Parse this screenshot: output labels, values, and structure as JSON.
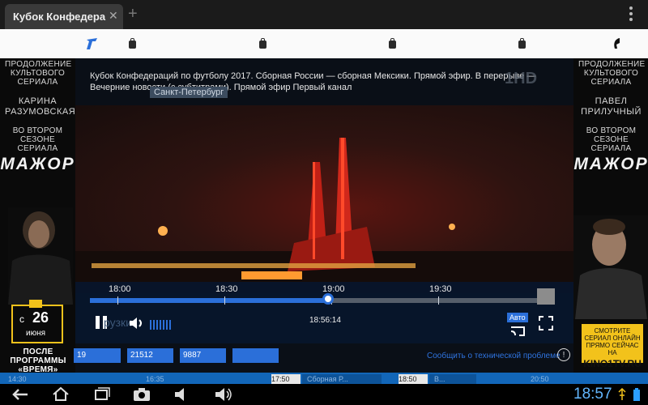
{
  "browser": {
    "tab_title": "Кубок Конфедера",
    "tab_close": "✕",
    "new_tab": "+"
  },
  "player": {
    "caption": "Кубок Конфедераций по футболу 2017. Сборная России — сборная Мексики. Прямой эфир. В перерыве — Вечерние новости (с субтитрами). Прямой эфир Первый канал",
    "location": "Санкт-Петербург",
    "channel_logo": "1HD",
    "timeline": {
      "ticks": [
        "18:00",
        "18:30",
        "19:00",
        "19:30"
      ],
      "progress": 0.53
    },
    "current_time": "18:56:14",
    "quality_label": "Авто",
    "ghost_text": "рузки..."
  },
  "left_ad": {
    "tagline": "ПРОДОЛЖЕНИЕ КУЛЬТОВОГО СЕРИАЛА",
    "actor": "КАРИНА РАЗУМОВСКАЯ",
    "season": "ВО ВТОРОМ СЕЗОНЕ СЕРИАЛА",
    "show": "МАЖОР",
    "date_prefix": "с",
    "date_day": "26",
    "date_month": "июня",
    "after": "ПОСЛЕ ПРОГРАММЫ «ВРЕМЯ»"
  },
  "right_ad": {
    "tagline": "ПРОДОЛЖЕНИЕ КУЛЬТОВОГО СЕРИАЛА",
    "actor": "ПАВЕЛ ПРИЛУЧНЫЙ",
    "season": "ВО ВТОРОМ СЕЗОНЕ СЕРИАЛА",
    "show": "МАЖОР",
    "cta": "СМОТРИТЕ СЕРИАЛ ОНЛАЙН ПРЯМО СЕЙЧАС НА",
    "brand": "KINO1TV.RU"
  },
  "counters": [
    "19",
    "21512",
    "9887",
    ""
  ],
  "report_link": "Сообщить о технической проблеме",
  "info_icon": "!",
  "ticker": {
    "items": [
      "14:30",
      "16:35",
      "17:50",
      "Сборная Р...",
      "18:50",
      "В...",
      "20:50"
    ]
  },
  "system": {
    "clock": "18:57"
  },
  "colors": {
    "accent": "#2b6fd9",
    "clock": "#63b7ff",
    "ad_yellow": "#f2c21b"
  },
  "icons": [
    "back-icon",
    "home-icon",
    "recent-apps-icon",
    "camera-icon",
    "volume-down-icon",
    "volume-up-icon",
    "pause-icon",
    "volume-icon",
    "chromecast-icon",
    "fullscreen-icon",
    "tv-icon",
    "phone-icon",
    "bag-icon",
    "wifi-icon",
    "battery-icon",
    "usb-icon"
  ]
}
